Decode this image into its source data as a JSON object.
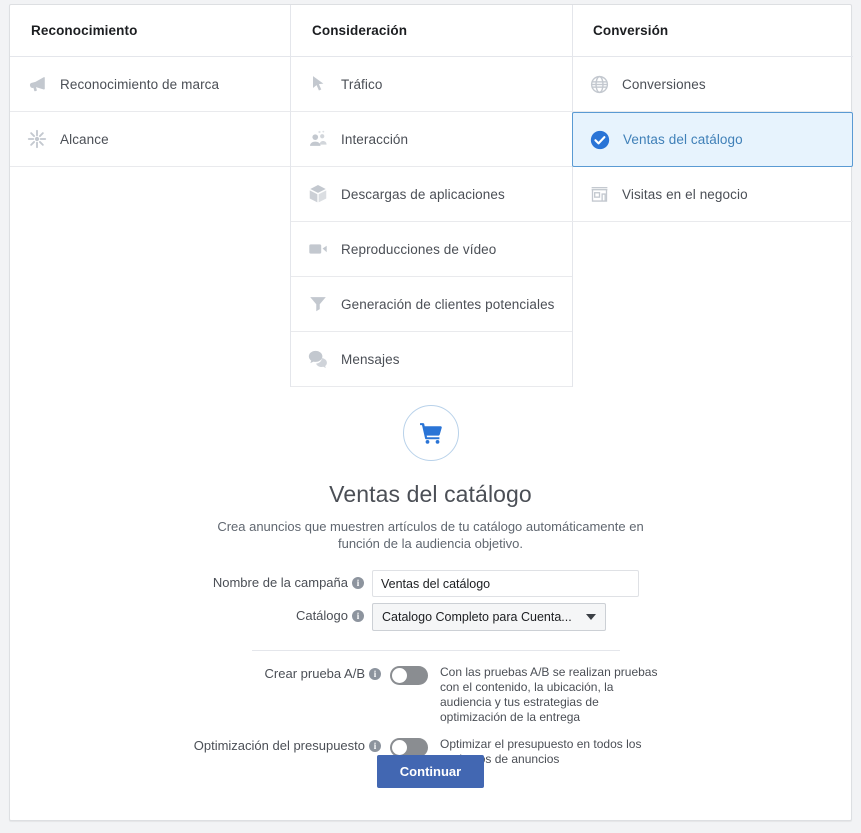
{
  "columns": [
    {
      "title": "Reconocimiento",
      "items": [
        {
          "label": "Reconocimiento de marca",
          "icon": "megaphone-icon",
          "selected": false
        },
        {
          "label": "Alcance",
          "icon": "reach-burst-icon",
          "selected": false
        }
      ]
    },
    {
      "title": "Consideración",
      "items": [
        {
          "label": "Tráfico",
          "icon": "cursor-icon",
          "selected": false
        },
        {
          "label": "Interacción",
          "icon": "people-icon",
          "selected": false
        },
        {
          "label": "Descargas de aplicaciones",
          "icon": "app-box-icon",
          "selected": false
        },
        {
          "label": "Reproducciones de vídeo",
          "icon": "video-camera-icon",
          "selected": false
        },
        {
          "label": "Generación de clientes potenciales",
          "icon": "funnel-icon",
          "selected": false
        },
        {
          "label": "Mensajes",
          "icon": "chat-bubbles-icon",
          "selected": false
        }
      ]
    },
    {
      "title": "Conversión",
      "items": [
        {
          "label": "Conversiones",
          "icon": "globe-icon",
          "selected": false
        },
        {
          "label": "Ventas del catálogo",
          "icon": "check-circle-icon",
          "selected": true
        },
        {
          "label": "Visitas en el negocio",
          "icon": "storefront-icon",
          "selected": false
        }
      ]
    }
  ],
  "hero": {
    "icon": "shopping-cart-icon",
    "title": "Ventas del catálogo",
    "description": "Crea anuncios que muestren artículos de tu catálogo automáticamente en función de la audiencia objetivo."
  },
  "form": {
    "campaign_name": {
      "label": "Nombre de la campaña",
      "info_icon": "info-icon",
      "value": "Ventas del catálogo",
      "placeholder": "Nombre de la campaña"
    },
    "catalog": {
      "label": "Catálogo",
      "info_icon": "info-icon",
      "selected_option": "Catalogo Completo para Cuenta...",
      "caret_icon": "caret-down-icon"
    },
    "ab_test": {
      "label": "Crear prueba A/B",
      "info_icon": "info-icon",
      "enabled": false,
      "help": "Con las pruebas A/B se realizan pruebas con el contenido, la ubicación, la audiencia y tus estrategias de optimización de la entrega"
    },
    "budget_optimization": {
      "label": "Optimización del presupuesto",
      "info_icon": "info-icon",
      "enabled": false,
      "help": "Optimizar el presupuesto en todos los conjuntos de anuncios"
    },
    "continue_button": "Continuar"
  },
  "colors": {
    "brand_blue": "#4267b2",
    "accent_blue": "#1877f2",
    "selected_bg": "#e7f3fd",
    "selected_border": "#5a9ad3",
    "icon_grey": "#bec3c9",
    "text_grey": "#4b4f56"
  }
}
